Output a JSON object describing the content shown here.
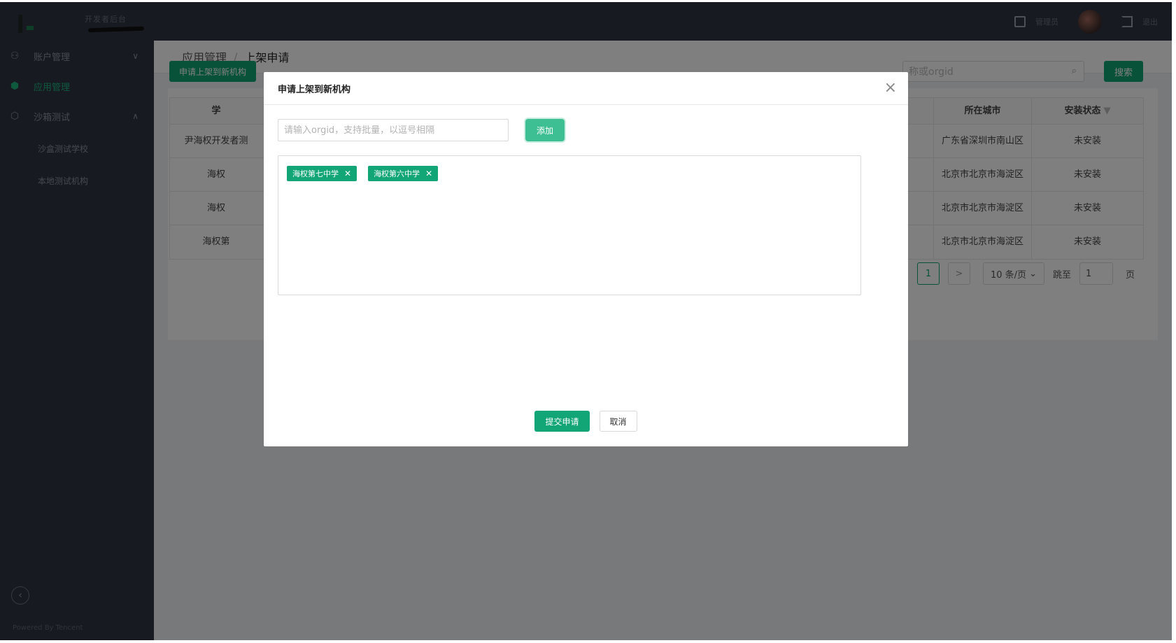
{
  "header": {
    "brand_text": "开发者后台",
    "user_name": "管理员",
    "logout_label": "退出"
  },
  "sidebar": {
    "items": [
      {
        "label": "账户管理",
        "icon": "users-icon",
        "chevron": "∨"
      },
      {
        "label": "应用管理",
        "icon": "cube-icon",
        "active": true
      },
      {
        "label": "沙箱测试",
        "icon": "box-icon",
        "chevron": "∧"
      }
    ],
    "sub_items": [
      {
        "label": "沙盒测试学校"
      },
      {
        "label": "本地测试机构"
      }
    ],
    "collapse_icon": "‹",
    "powered_by": "Powered By Tencent"
  },
  "breadcrumb": {
    "parent": "应用管理",
    "separator": "/",
    "current": "上架申请"
  },
  "toolbar": {
    "apply_button": "申请上架到新机构",
    "search_placeholder": "称或orgid",
    "search_button": "搜索"
  },
  "table": {
    "headers": {
      "col1": "学",
      "city": "所在城市",
      "state": "安装状态"
    },
    "rows": [
      {
        "name": "尹海权开发者测",
        "city": "广东省深圳市南山区",
        "state": "未安装"
      },
      {
        "name": "海权",
        "city": "北京市北京市海淀区",
        "state": "未安装"
      },
      {
        "name": "海权",
        "city": "北京市北京市海淀区",
        "state": "未安装"
      },
      {
        "name": "海权第",
        "city": "北京市北京市海淀区",
        "state": "未安装"
      }
    ]
  },
  "pagination": {
    "current_page": "1",
    "next": ">",
    "page_size": "10 条/页",
    "jump_label": "跳至",
    "jump_value": "1",
    "page_suffix": "页"
  },
  "modal": {
    "title": "申请上架到新机构",
    "close_icon": "×",
    "input_placeholder": "请输入orgid，支持批量，以逗号相隔",
    "add_button": "添加",
    "tags": [
      {
        "label": "海权第七中学"
      },
      {
        "label": "海权第六中学"
      }
    ],
    "submit_button": "提交申请",
    "cancel_button": "取消"
  },
  "colors": {
    "primary": "#12a575",
    "sidebar_bg": "#2f3542"
  }
}
